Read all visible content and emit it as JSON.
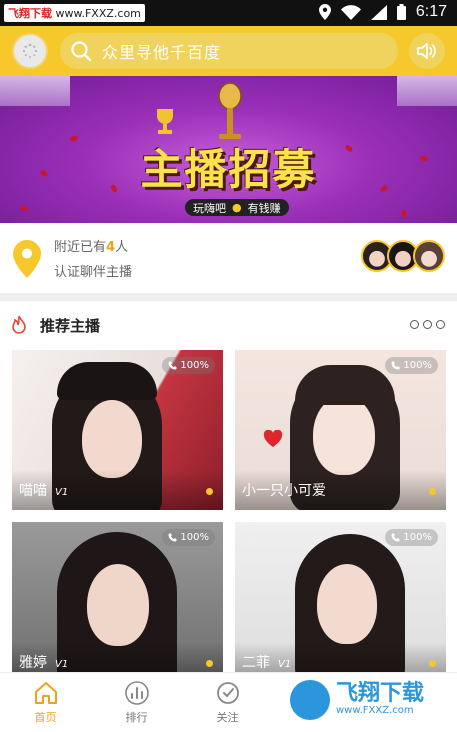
{
  "status_bar": {
    "watermark_brand": "飞翔下载",
    "watermark_url": "www.FXXZ.com",
    "time": "6:17"
  },
  "header": {
    "search_placeholder": "众里寻他千百度"
  },
  "banner": {
    "title": "主播招募",
    "tag_left": "玩嗨吧",
    "tag_right": "有钱赚"
  },
  "nearby": {
    "prefix": "附近已有",
    "count": "4",
    "suffix": "人",
    "subtitle": "认证聊伴主播"
  },
  "section": {
    "title": "推荐主播"
  },
  "cards": [
    {
      "name": "喵喵",
      "level": "V1",
      "badge": "100%"
    },
    {
      "name": "小一只小可爱",
      "level": "",
      "badge": "100%"
    },
    {
      "name": "雅婷",
      "level": "V1",
      "badge": "100%"
    },
    {
      "name": "二菲",
      "level": "V1",
      "badge": "100%"
    }
  ],
  "bottom_nav": [
    {
      "label": "首页",
      "icon": "home-icon",
      "active": true
    },
    {
      "label": "排行",
      "icon": "ranking-icon",
      "active": false
    },
    {
      "label": "关注",
      "icon": "follow-icon",
      "active": false
    }
  ],
  "site_watermark": {
    "brand": "飞翔下载",
    "url": "www.FXXZ.com"
  },
  "colors": {
    "accent": "#f7c82c",
    "accent_text": "#f0a21a"
  }
}
